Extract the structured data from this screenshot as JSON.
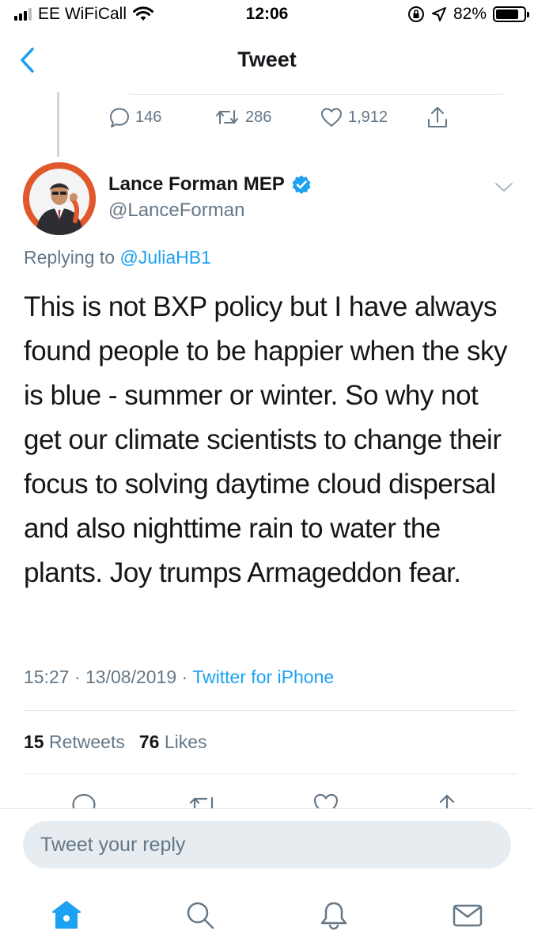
{
  "status_bar": {
    "carrier": "EE WiFiCall",
    "time": "12:06",
    "battery_percent": "82%",
    "battery_level": 0.82
  },
  "nav": {
    "title": "Tweet",
    "back_icon": "chevron-left-icon"
  },
  "previous_tweet_actions": {
    "replies": "146",
    "retweets": "286",
    "likes": "1,912"
  },
  "tweet": {
    "author_name": "Lance Forman MEP",
    "verified": true,
    "handle": "@LanceForman",
    "replying_prefix": "Replying to",
    "replying_to": "@JuliaHB1",
    "text": "This is not BXP policy but I have always found people to be happier when the sky is blue - summer or winter. So why not get our climate scientists to change their focus to solving daytime cloud dispersal and also nighttime rain to water the plants. Joy trumps Armageddon fear.",
    "time": "15:27",
    "date": "13/08/2019",
    "separator": "·",
    "source": "Twitter for iPhone",
    "retweets_count": "15",
    "retweets_label": "Retweets",
    "likes_count": "76",
    "likes_label": "Likes"
  },
  "composer": {
    "placeholder": "Tweet your reply"
  },
  "tab_bar": {
    "tabs": [
      "home-icon",
      "search-icon",
      "notifications-icon",
      "messages-icon"
    ],
    "active_color": "#1da1f2",
    "inactive_color": "#657786"
  },
  "colors": {
    "accent": "#1da1f2",
    "secondary_text": "#657786",
    "primary_text": "#14171a"
  }
}
